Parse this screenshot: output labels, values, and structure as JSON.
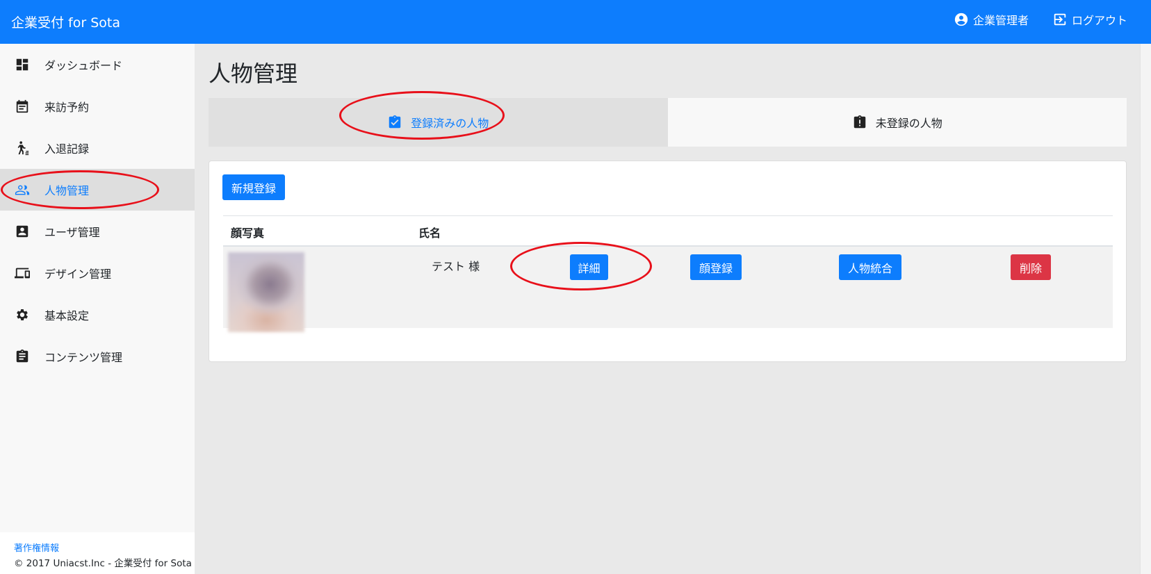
{
  "app": {
    "title": "企業受付 for Sota"
  },
  "header": {
    "user_label": "企業管理者",
    "logout_label": "ログアウト"
  },
  "sidebar": {
    "items": [
      {
        "label": "ダッシュボード",
        "icon": "dashboard-icon"
      },
      {
        "label": "来訪予約",
        "icon": "calendar-icon"
      },
      {
        "label": "入退記録",
        "icon": "walker-icon"
      },
      {
        "label": "人物管理",
        "icon": "people-icon",
        "active": true
      },
      {
        "label": "ユーザ管理",
        "icon": "account-box-icon"
      },
      {
        "label": "デザイン管理",
        "icon": "devices-icon"
      },
      {
        "label": "基本設定",
        "icon": "gear-icon"
      },
      {
        "label": "コンテンツ管理",
        "icon": "clipboard-icon"
      }
    ],
    "footer_link": "著作権情報",
    "copyright": "© 2017 Uniacst.Inc - 企業受付 for Sota"
  },
  "main": {
    "title": "人物管理",
    "tabs": [
      {
        "label": "登録済みの人物",
        "icon": "clipboard-check-icon",
        "active": true
      },
      {
        "label": "未登録の人物",
        "icon": "clipboard-alert-icon",
        "active": false
      }
    ],
    "new_button": "新規登録",
    "table": {
      "headers": [
        "顔写真",
        "氏名"
      ],
      "rows": [
        {
          "name": "テスト 様",
          "actions": [
            "詳細",
            "顔登録",
            "人物統合",
            "削除"
          ]
        }
      ]
    }
  },
  "colors": {
    "primary": "#0d7dfd",
    "danger": "#dc3545",
    "annotation": "#e8101a"
  }
}
